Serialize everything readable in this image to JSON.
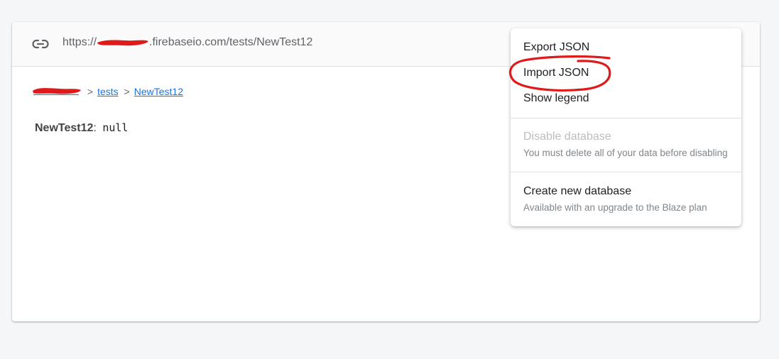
{
  "url_bar": {
    "prefix": "https://",
    "suffix": ".firebaseio.com/tests/NewTest12",
    "link_icon": "link-icon"
  },
  "breadcrumb": {
    "items": [
      {
        "label": "tests"
      },
      {
        "label": "NewTest12"
      }
    ],
    "separator": ">"
  },
  "node": {
    "key": "NewTest12",
    "colon": ":",
    "value": "null"
  },
  "menu": {
    "export_json": "Export JSON",
    "import_json": "Import JSON",
    "show_legend": "Show legend",
    "disable_database": "Disable database",
    "disable_note": "You must delete all of your data before disabling",
    "create_database": "Create new database",
    "create_note": "Available with an upgrade to the Blaze plan"
  },
  "colors": {
    "page_bg": "#f5f6f8",
    "link": "#1a73e8",
    "annotation_red": "#e01a1a",
    "redaction_red": "#e01a1a"
  }
}
